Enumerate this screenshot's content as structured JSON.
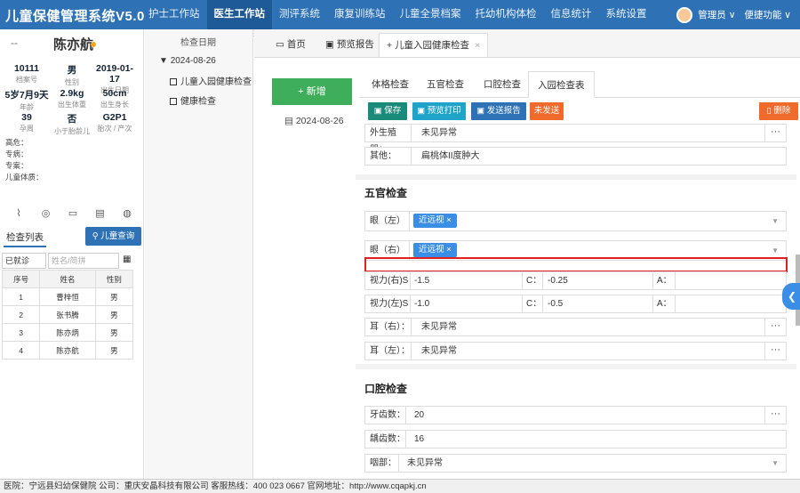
{
  "app": {
    "title": "儿童保健管理系统V5.0"
  },
  "nav": {
    "items": [
      "护士工作站",
      "医生工作站",
      "测评系统",
      "康复训练站",
      "儿童全景档案",
      "托幼机构体检",
      "信息统计",
      "系统设置"
    ],
    "active": "医生工作站",
    "user": "管理员 ∨",
    "shortcut": "便捷功能 ∨"
  },
  "patient": {
    "dash": "--",
    "name": "陈亦航",
    "stats": [
      {
        "value": "10111",
        "label": "档案号"
      },
      {
        "value": "男",
        "label": "性别"
      },
      {
        "value": "2019-01-17",
        "label": "出生日期"
      },
      {
        "value": "5岁7月9天",
        "label": "年龄"
      },
      {
        "value": "2.9kg",
        "label": "出生体重"
      },
      {
        "value": "50cm",
        "label": "出生身长"
      },
      {
        "value": "39",
        "label": "孕周"
      },
      {
        "value": "否",
        "label": "小于胎龄儿"
      },
      {
        "value": "G2P1",
        "label": "胎次 / 产次"
      }
    ],
    "notes": [
      "高危：",
      "专病：",
      "专案：",
      "儿童体质："
    ]
  },
  "left": {
    "list_tab": "检查列表",
    "search_child": "儿童查询",
    "filter_status": "已就诊",
    "filter_placeholder": "姓名/简拼",
    "table_headers": [
      "序号",
      "姓名",
      "性别"
    ],
    "table_rows": [
      [
        "1",
        "曹梓恒",
        "男"
      ],
      [
        "2",
        "张书腾",
        "男"
      ],
      [
        "3",
        "陈亦炳",
        "男"
      ],
      [
        "4",
        "陈亦航",
        "男"
      ]
    ]
  },
  "datetree": {
    "header": "检查日期",
    "node": "2024-08-26",
    "leaves": [
      "儿童入园健康检查",
      "健康检查"
    ]
  },
  "page_tabs": {
    "home": "首页",
    "preview": "预览报告",
    "current": "儿童入园健康检查"
  },
  "side": {
    "new_label": "新增",
    "date": "2024-08-26"
  },
  "subtabs": [
    "体格检查",
    "五官检查",
    "口腔检查",
    "入园检查表"
  ],
  "subtab_active": "入园检查表",
  "toolbar": {
    "save": "保存",
    "print": "预览打印",
    "send": "发送报告",
    "unsent": "未发送",
    "delete": "删除",
    "colors": {
      "save": "#1a8a7a",
      "print": "#1fa3c9",
      "send": "#2e72b5",
      "unsent": "#f06a2c",
      "delete": "#f06a2c"
    }
  },
  "form": {
    "genitals_label": "外生殖器：",
    "genitals_value": "未见异常",
    "other_label": "其他：",
    "other_value": "扁桃体II度肿大",
    "section_facial": "五官检查",
    "eye_left_label": "眼（左）",
    "eye_left_tag": "近远视",
    "eye_right_label": "眼（右）",
    "eye_right_tag": "近远视",
    "vision_right_label": "视力(右)S",
    "vision_right_s": "-1.5",
    "vision_right_c_label": "C：",
    "vision_right_c": "-0.25",
    "vision_right_a_label": "A：",
    "vision_left_label": "视力(左)S",
    "vision_left_s": "-1.0",
    "vision_left_c_label": "C：",
    "vision_left_c": "-0.5",
    "vision_left_a_label": "A：",
    "ear_right_label": "耳（右）：",
    "ear_right_value": "未见异常",
    "ear_left_label": "耳（左）：",
    "ear_left_value": "未见异常",
    "section_oral": "口腔检查",
    "teeth_label": "牙齿数：",
    "teeth_value": "20",
    "caries_label": "龋齿数：",
    "caries_value": "16",
    "throat_label": "咽部：",
    "throat_value": "未见异常"
  },
  "footer": "医院：宁远县妇幼保健院   公司：重庆安晶科技有限公司   客服热线：400 023 0667   官网地址：http://www.cqapkj.cn"
}
